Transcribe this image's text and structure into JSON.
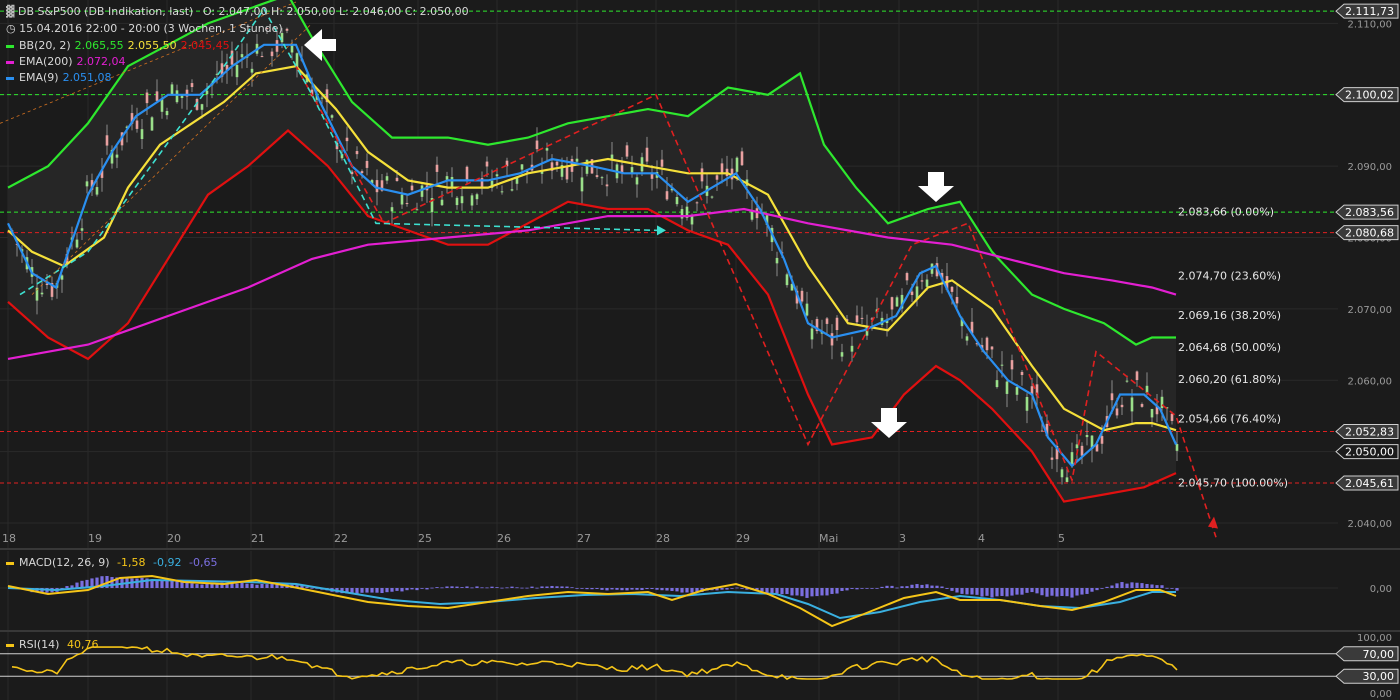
{
  "header": {
    "title": "DB S&P500 (DB Indikation, last)",
    "ohlc": "O: 2.047,00  H: 2.050,00  L: 2.046,00  C: 2.050,00",
    "period": "15.04.2016 22:00 - 20:00 (3 Wochen, 1 Stunde)"
  },
  "legend": [
    {
      "label": "BB(20, 2)",
      "values": [
        {
          "text": "2.065,55",
          "color": "#2ee82e"
        },
        {
          "text": "2.055,50",
          "color": "#f5e03a"
        },
        {
          "text": "2.045,45",
          "color": "#e01010"
        }
      ],
      "color": "#2ee82e"
    },
    {
      "label": "EMA(200)",
      "values": [
        {
          "text": "2.072,04",
          "color": "#e31fd2"
        }
      ],
      "color": "#e31fd2"
    },
    {
      "label": "EMA(9)",
      "values": [
        {
          "text": "2.051,08",
          "color": "#2a8ff0"
        }
      ],
      "color": "#2a8ff0"
    }
  ],
  "colors": {
    "bb_upper": "#2ee82e",
    "bb_mid": "#f5e03a",
    "bb_lower": "#e01010",
    "ema200": "#e31fd2",
    "ema9": "#2a8ff0",
    "trend": "#e02020",
    "cyan": "#3de0d0",
    "up_candle": "#9adf8a",
    "down_candle": "#e8a0a0",
    "macd_hist": "#7b6fe0",
    "macd_line": "#f5c518",
    "signal_line": "#3ab0e0",
    "rsi": "#f5c518"
  },
  "chart_data": [
    {
      "type": "line",
      "title": "DB S&P500 (DB Indikation, last)",
      "x_labels": [
        "18",
        "19",
        "20",
        "21",
        "22",
        "25",
        "26",
        "27",
        "28",
        "29",
        "Mai",
        "3",
        "4",
        "5"
      ],
      "yticks": [
        "2.040,00",
        "2.050,00",
        "2.060,00",
        "2.070,00",
        "2.080,00",
        "2.090,00",
        "2.100,00",
        "2.110,00"
      ],
      "ylim": [
        2036.5,
        2113
      ],
      "price_tags": [
        "2.111,73",
        "2.100,02",
        "2.083,56",
        "2.080,68",
        "2.052,83",
        "2.050,00",
        "2.045,61"
      ],
      "horizontal_levels": [
        {
          "value": 2111.73,
          "color": "#2ee82e",
          "style": "dashed"
        },
        {
          "value": 2100.02,
          "color": "#2ee82e",
          "style": "dashed"
        },
        {
          "value": 2083.56,
          "color": "#2ee82e",
          "style": "dashed"
        },
        {
          "value": 2080.68,
          "color": "#e02020",
          "style": "dashed"
        },
        {
          "value": 2052.83,
          "color": "#e02020",
          "style": "dashed"
        },
        {
          "value": 2045.61,
          "color": "#e02020",
          "style": "dashed"
        }
      ],
      "fibonacci": [
        {
          "label": "2.083,66 (0.00%)",
          "value": 2083.66
        },
        {
          "label": "2.074,70 (23.60%)",
          "value": 2074.7
        },
        {
          "label": "2.069,16 (38.20%)",
          "value": 2069.16
        },
        {
          "label": "2.064,68 (50.00%)",
          "value": 2064.68
        },
        {
          "label": "2.060,20 (61.80%)",
          "value": 2060.2
        },
        {
          "label": "2.054,66 (76.40%)",
          "value": 2054.66
        },
        {
          "label": "2.045,70 (100.00%)",
          "value": 2045.7
        }
      ],
      "series": [
        {
          "name": "BB(20, 2)",
          "color": "#2ee82e",
          "points": [
            [
              0,
              2087
            ],
            [
              0.5,
              2090
            ],
            [
              1,
              2096
            ],
            [
              1.5,
              2104
            ],
            [
              2,
              2107
            ],
            [
              2.5,
              2110
            ],
            [
              3,
              2112
            ],
            [
              3.5,
              2114
            ],
            [
              3.8,
              2108
            ],
            [
              4.3,
              2099
            ],
            [
              4.8,
              2094
            ],
            [
              5.5,
              2094
            ],
            [
              6,
              2093
            ],
            [
              6.5,
              2094
            ],
            [
              7,
              2096
            ],
            [
              7.5,
              2097
            ],
            [
              8,
              2098
            ],
            [
              8.5,
              2097
            ],
            [
              9,
              2101
            ],
            [
              9.5,
              2100
            ],
            [
              9.9,
              2103
            ],
            [
              10.2,
              2093
            ],
            [
              10.6,
              2087
            ],
            [
              11,
              2082
            ],
            [
              11.5,
              2084
            ],
            [
              11.9,
              2085
            ],
            [
              12.3,
              2078
            ],
            [
              12.8,
              2072
            ],
            [
              13.2,
              2070
            ],
            [
              13.7,
              2068
            ],
            [
              14.1,
              2065
            ],
            [
              14.3,
              2066
            ],
            [
              14.6,
              2066
            ]
          ]
        },
        {
          "name": "BB(20, 2) mid",
          "color": "#f5e03a",
          "points": [
            [
              0,
              2081
            ],
            [
              0.3,
              2078
            ],
            [
              0.7,
              2076
            ],
            [
              1.2,
              2080
            ],
            [
              1.5,
              2087
            ],
            [
              1.9,
              2093
            ],
            [
              2.3,
              2096
            ],
            [
              2.7,
              2099
            ],
            [
              3.1,
              2103
            ],
            [
              3.6,
              2104
            ],
            [
              4.1,
              2098
            ],
            [
              4.5,
              2092
            ],
            [
              5,
              2088
            ],
            [
              5.5,
              2087
            ],
            [
              6,
              2087
            ],
            [
              6.5,
              2089
            ],
            [
              7,
              2090
            ],
            [
              7.5,
              2091
            ],
            [
              8,
              2090
            ],
            [
              8.5,
              2089
            ],
            [
              9,
              2089
            ],
            [
              9.5,
              2086
            ],
            [
              10,
              2076
            ],
            [
              10.5,
              2068
            ],
            [
              11,
              2067
            ],
            [
              11.5,
              2073
            ],
            [
              11.8,
              2074
            ],
            [
              12.3,
              2070
            ],
            [
              12.8,
              2062
            ],
            [
              13.2,
              2056
            ],
            [
              13.7,
              2053
            ],
            [
              14.1,
              2054
            ],
            [
              14.3,
              2054
            ],
            [
              14.6,
              2053
            ]
          ]
        },
        {
          "name": "BB(20, 2) lower",
          "color": "#e01010",
          "points": [
            [
              0,
              2071
            ],
            [
              0.5,
              2066
            ],
            [
              1,
              2063
            ],
            [
              1.5,
              2068
            ],
            [
              2,
              2077
            ],
            [
              2.5,
              2086
            ],
            [
              3,
              2090
            ],
            [
              3.5,
              2095
            ],
            [
              4,
              2090
            ],
            [
              4.5,
              2083
            ],
            [
              5,
              2081
            ],
            [
              5.5,
              2079
            ],
            [
              6,
              2079
            ],
            [
              6.5,
              2082
            ],
            [
              7,
              2085
            ],
            [
              7.5,
              2084
            ],
            [
              8,
              2084
            ],
            [
              8.5,
              2081
            ],
            [
              9,
              2079
            ],
            [
              9.5,
              2072
            ],
            [
              10,
              2058
            ],
            [
              10.3,
              2051
            ],
            [
              10.8,
              2052
            ],
            [
              11.2,
              2058
            ],
            [
              11.6,
              2062
            ],
            [
              11.9,
              2060
            ],
            [
              12.3,
              2056
            ],
            [
              12.8,
              2050
            ],
            [
              13.2,
              2043
            ],
            [
              13.7,
              2044
            ],
            [
              14.2,
              2045
            ],
            [
              14.6,
              2047
            ]
          ]
        },
        {
          "name": "EMA(200)",
          "color": "#e31fd2",
          "points": [
            [
              0,
              2063
            ],
            [
              1,
              2065
            ],
            [
              2,
              2069
            ],
            [
              3,
              2073
            ],
            [
              3.8,
              2077
            ],
            [
              4.5,
              2079
            ],
            [
              5.5,
              2080
            ],
            [
              6.5,
              2081
            ],
            [
              7.5,
              2083
            ],
            [
              8.5,
              2083
            ],
            [
              9.2,
              2084
            ],
            [
              10,
              2082
            ],
            [
              11,
              2080
            ],
            [
              11.8,
              2079
            ],
            [
              12.5,
              2077
            ],
            [
              13.2,
              2075
            ],
            [
              13.8,
              2074
            ],
            [
              14.3,
              2073
            ],
            [
              14.6,
              2072
            ]
          ]
        },
        {
          "name": "EMA(9)",
          "color": "#2a8ff0",
          "points": [
            [
              0,
              2082
            ],
            [
              0.3,
              2075
            ],
            [
              0.6,
              2073
            ],
            [
              1,
              2086
            ],
            [
              1.3,
              2092
            ],
            [
              1.6,
              2097
            ],
            [
              2,
              2100
            ],
            [
              2.4,
              2100
            ],
            [
              2.8,
              2104
            ],
            [
              3.2,
              2107
            ],
            [
              3.6,
              2107
            ],
            [
              3.9,
              2099
            ],
            [
              4.3,
              2090
            ],
            [
              4.6,
              2087
            ],
            [
              5,
              2086
            ],
            [
              5.5,
              2088
            ],
            [
              6,
              2088
            ],
            [
              6.4,
              2089
            ],
            [
              6.8,
              2091
            ],
            [
              7.3,
              2090
            ],
            [
              7.7,
              2089
            ],
            [
              8.1,
              2089
            ],
            [
              8.5,
              2085
            ],
            [
              8.8,
              2087
            ],
            [
              9.1,
              2089
            ],
            [
              9.4,
              2084
            ],
            [
              9.7,
              2077
            ],
            [
              10,
              2068
            ],
            [
              10.3,
              2066
            ],
            [
              10.7,
              2067
            ],
            [
              11.1,
              2069
            ],
            [
              11.4,
              2075
            ],
            [
              11.6,
              2076
            ],
            [
              11.9,
              2069
            ],
            [
              12.2,
              2064
            ],
            [
              12.5,
              2060
            ],
            [
              12.8,
              2058
            ],
            [
              13,
              2052
            ],
            [
              13.3,
              2048
            ],
            [
              13.6,
              2051
            ],
            [
              13.9,
              2058
            ],
            [
              14.2,
              2058
            ],
            [
              14.4,
              2056
            ],
            [
              14.6,
              2051
            ]
          ]
        }
      ]
    },
    {
      "type": "bar",
      "title": "MACD(12, 26, 9)",
      "values_text": [
        "-1,58",
        "-0,92",
        "-0,65"
      ],
      "yticks": [
        "0,00"
      ],
      "note": "histogram and two lines oscillating around 0"
    },
    {
      "type": "line",
      "title": "RSI(14)",
      "value_text": "40,76",
      "yticks": [
        "100,00",
        "70,00",
        "30,00",
        "0,00"
      ],
      "ylim": [
        0,
        100
      ]
    }
  ]
}
